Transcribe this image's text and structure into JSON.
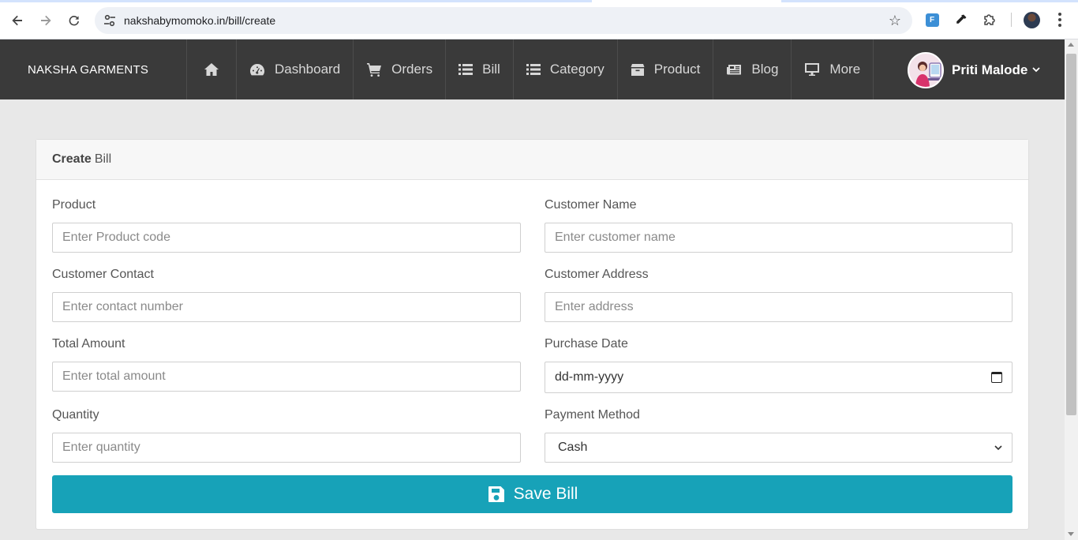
{
  "browser": {
    "url": "nakshabymomoko.in/bill/create"
  },
  "navbar": {
    "brand": "NAKSHA GARMENTS",
    "items": [
      {
        "label": "",
        "icon": "home-icon"
      },
      {
        "label": "Dashboard",
        "icon": "dashboard-icon"
      },
      {
        "label": "Orders",
        "icon": "cart-icon"
      },
      {
        "label": "Bill",
        "icon": "list-icon"
      },
      {
        "label": "Category",
        "icon": "list-icon"
      },
      {
        "label": "Product",
        "icon": "box-icon"
      },
      {
        "label": "Blog",
        "icon": "newspaper-icon"
      },
      {
        "label": "More",
        "icon": "desktop-icon"
      }
    ],
    "user": {
      "name": "Priti Malode"
    }
  },
  "card": {
    "title_bold": "Create",
    "title_rest": "Bill"
  },
  "form": {
    "product": {
      "label": "Product",
      "placeholder": "Enter Product code"
    },
    "customer_name": {
      "label": "Customer Name",
      "placeholder": "Enter customer name"
    },
    "customer_contact": {
      "label": "Customer Contact",
      "placeholder": "Enter contact number"
    },
    "customer_address": {
      "label": "Customer Address",
      "placeholder": "Enter address"
    },
    "total_amount": {
      "label": "Total Amount",
      "placeholder": "Enter total amount"
    },
    "purchase_date": {
      "label": "Purchase Date",
      "placeholder": "dd-mm-yyyy"
    },
    "quantity": {
      "label": "Quantity",
      "placeholder": "Enter quantity"
    },
    "payment_method": {
      "label": "Payment Method",
      "value": "Cash"
    },
    "save_label": "Save Bill"
  },
  "colors": {
    "navbar_bg": "#3a3a3a",
    "save_button": "#17a2b8",
    "page_bg": "#e8e8e8"
  }
}
